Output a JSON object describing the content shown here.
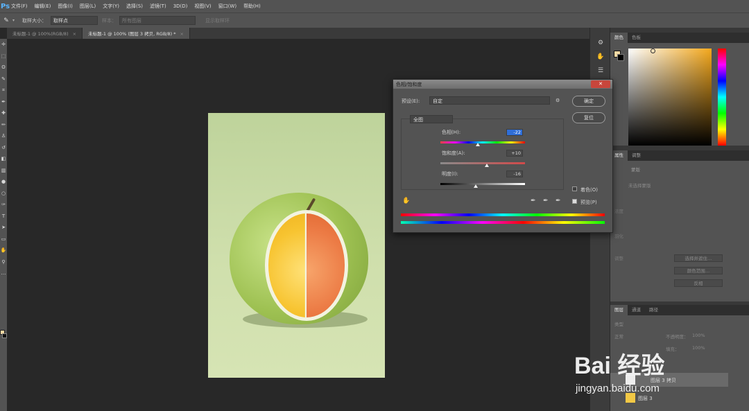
{
  "app": {
    "logo": "Ps"
  },
  "menu": [
    "文件(F)",
    "编辑(E)",
    "图像(I)",
    "图层(L)",
    "文字(Y)",
    "选择(S)",
    "滤镜(T)",
    "3D(D)",
    "视图(V)",
    "窗口(W)",
    "帮助(H)"
  ],
  "options": {
    "sample_size_label": "取样大小：",
    "sample_size_value": "取样点",
    "sample_label": "样本：",
    "sample_value": "所有图层",
    "show_ring": "显示取样环"
  },
  "tabs": [
    {
      "label": "未标题-1 @ 100%(RGB/8)",
      "close": "×"
    },
    {
      "label": "未标题-1 @ 100% (图层 3 拷贝, RGB/8) *",
      "close": "×"
    }
  ],
  "color_panel": {
    "tabs": [
      "颜色",
      "色板"
    ],
    "fg_color": "#f3d9a4",
    "bg_color": "#111111",
    "accent": "#f4a81c"
  },
  "props_panel": {
    "tabs": [
      "属性",
      "调整"
    ],
    "title": "蒙版",
    "layer_mask": "未选择蒙版",
    "rows": [
      "浓度",
      "羽化",
      "调整"
    ],
    "buttons": [
      "选择并遮住…",
      "颜色范围…",
      "反相"
    ]
  },
  "layers_panel": {
    "tabs": [
      "图层",
      "通道",
      "路径"
    ],
    "kind": "类型",
    "blend": "正常",
    "opacity_label": "不透明度：",
    "opacity": "100%",
    "fill_label": "填充：",
    "fill": "100%",
    "layers": [
      {
        "name": "图层 3 拷贝",
        "selected": true
      },
      {
        "name": "图层 3",
        "selected": false
      }
    ]
  },
  "dialog": {
    "title": "色相/饱和度",
    "close": "✕",
    "preset_label": "预设(E):",
    "preset_value": "自定",
    "channel": "全图",
    "ok": "确定",
    "reset": "复位",
    "hue_label": "色相(H):",
    "hue_value": "-22",
    "sat_label": "饱和度(A):",
    "sat_value": "+10",
    "light_label": "明度(I):",
    "light_value": "-16",
    "colorize": "着色(O)",
    "colorize_checked": false,
    "preview": "预览(P)",
    "preview_checked": true,
    "hue_level": -22,
    "sat_level": 10,
    "light_level": -16
  },
  "watermark": {
    "text": "Bai 经验",
    "url": "jingyan.baidu.com"
  }
}
